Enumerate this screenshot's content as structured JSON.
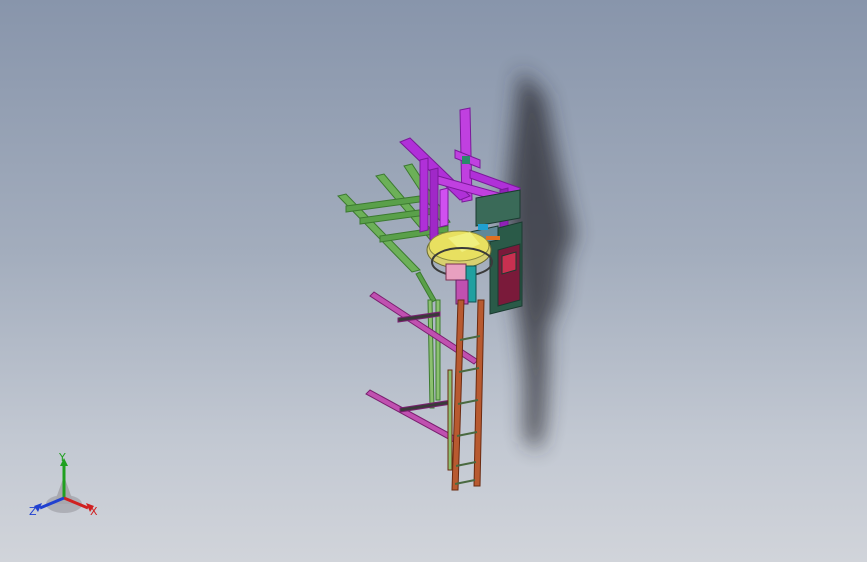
{
  "colors": {
    "background_top": "#8895ab",
    "background_bottom": "#d1d4da",
    "frame_magenta": "#b030d8",
    "frame_green": "#5aa04a",
    "ladder_orange": "#b85a30",
    "rail_pink": "#c050b0",
    "disc_yellow": "#e8e060",
    "axis_x": "#d02020",
    "axis_y": "#20a020",
    "axis_z": "#2040d0"
  },
  "triad": {
    "x_label": "X",
    "y_label": "Y",
    "z_label": "Z"
  }
}
